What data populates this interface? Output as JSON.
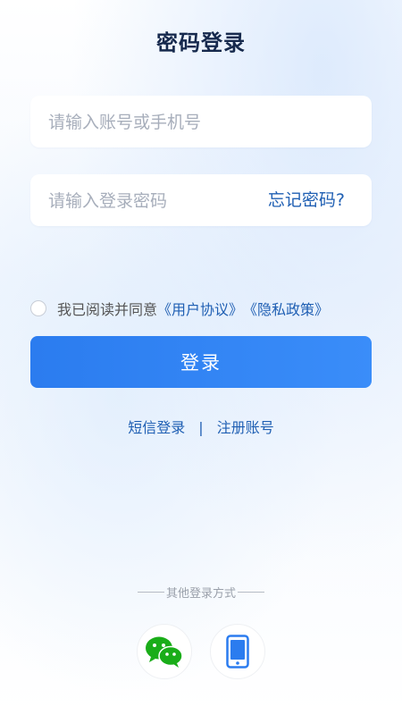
{
  "header": {
    "title": "密码登录"
  },
  "form": {
    "account_placeholder": "请输入账号或手机号",
    "password_placeholder": "请输入登录密码",
    "forgot_label": "忘记密码?"
  },
  "agreement": {
    "prefix": "我已阅读并同意",
    "user_agreement": "《用户协议》",
    "privacy_policy": "《隐私政策》"
  },
  "login_button": "登录",
  "links": {
    "sms_login": "短信登录",
    "separator": "|",
    "register": "注册账号"
  },
  "other_login": {
    "label": "其他登录方式",
    "icons": [
      "wechat-icon",
      "phone-icon"
    ]
  },
  "colors": {
    "accent": "#2b7cef",
    "link": "#1f5fb3",
    "wechat_green": "#1aad19"
  }
}
